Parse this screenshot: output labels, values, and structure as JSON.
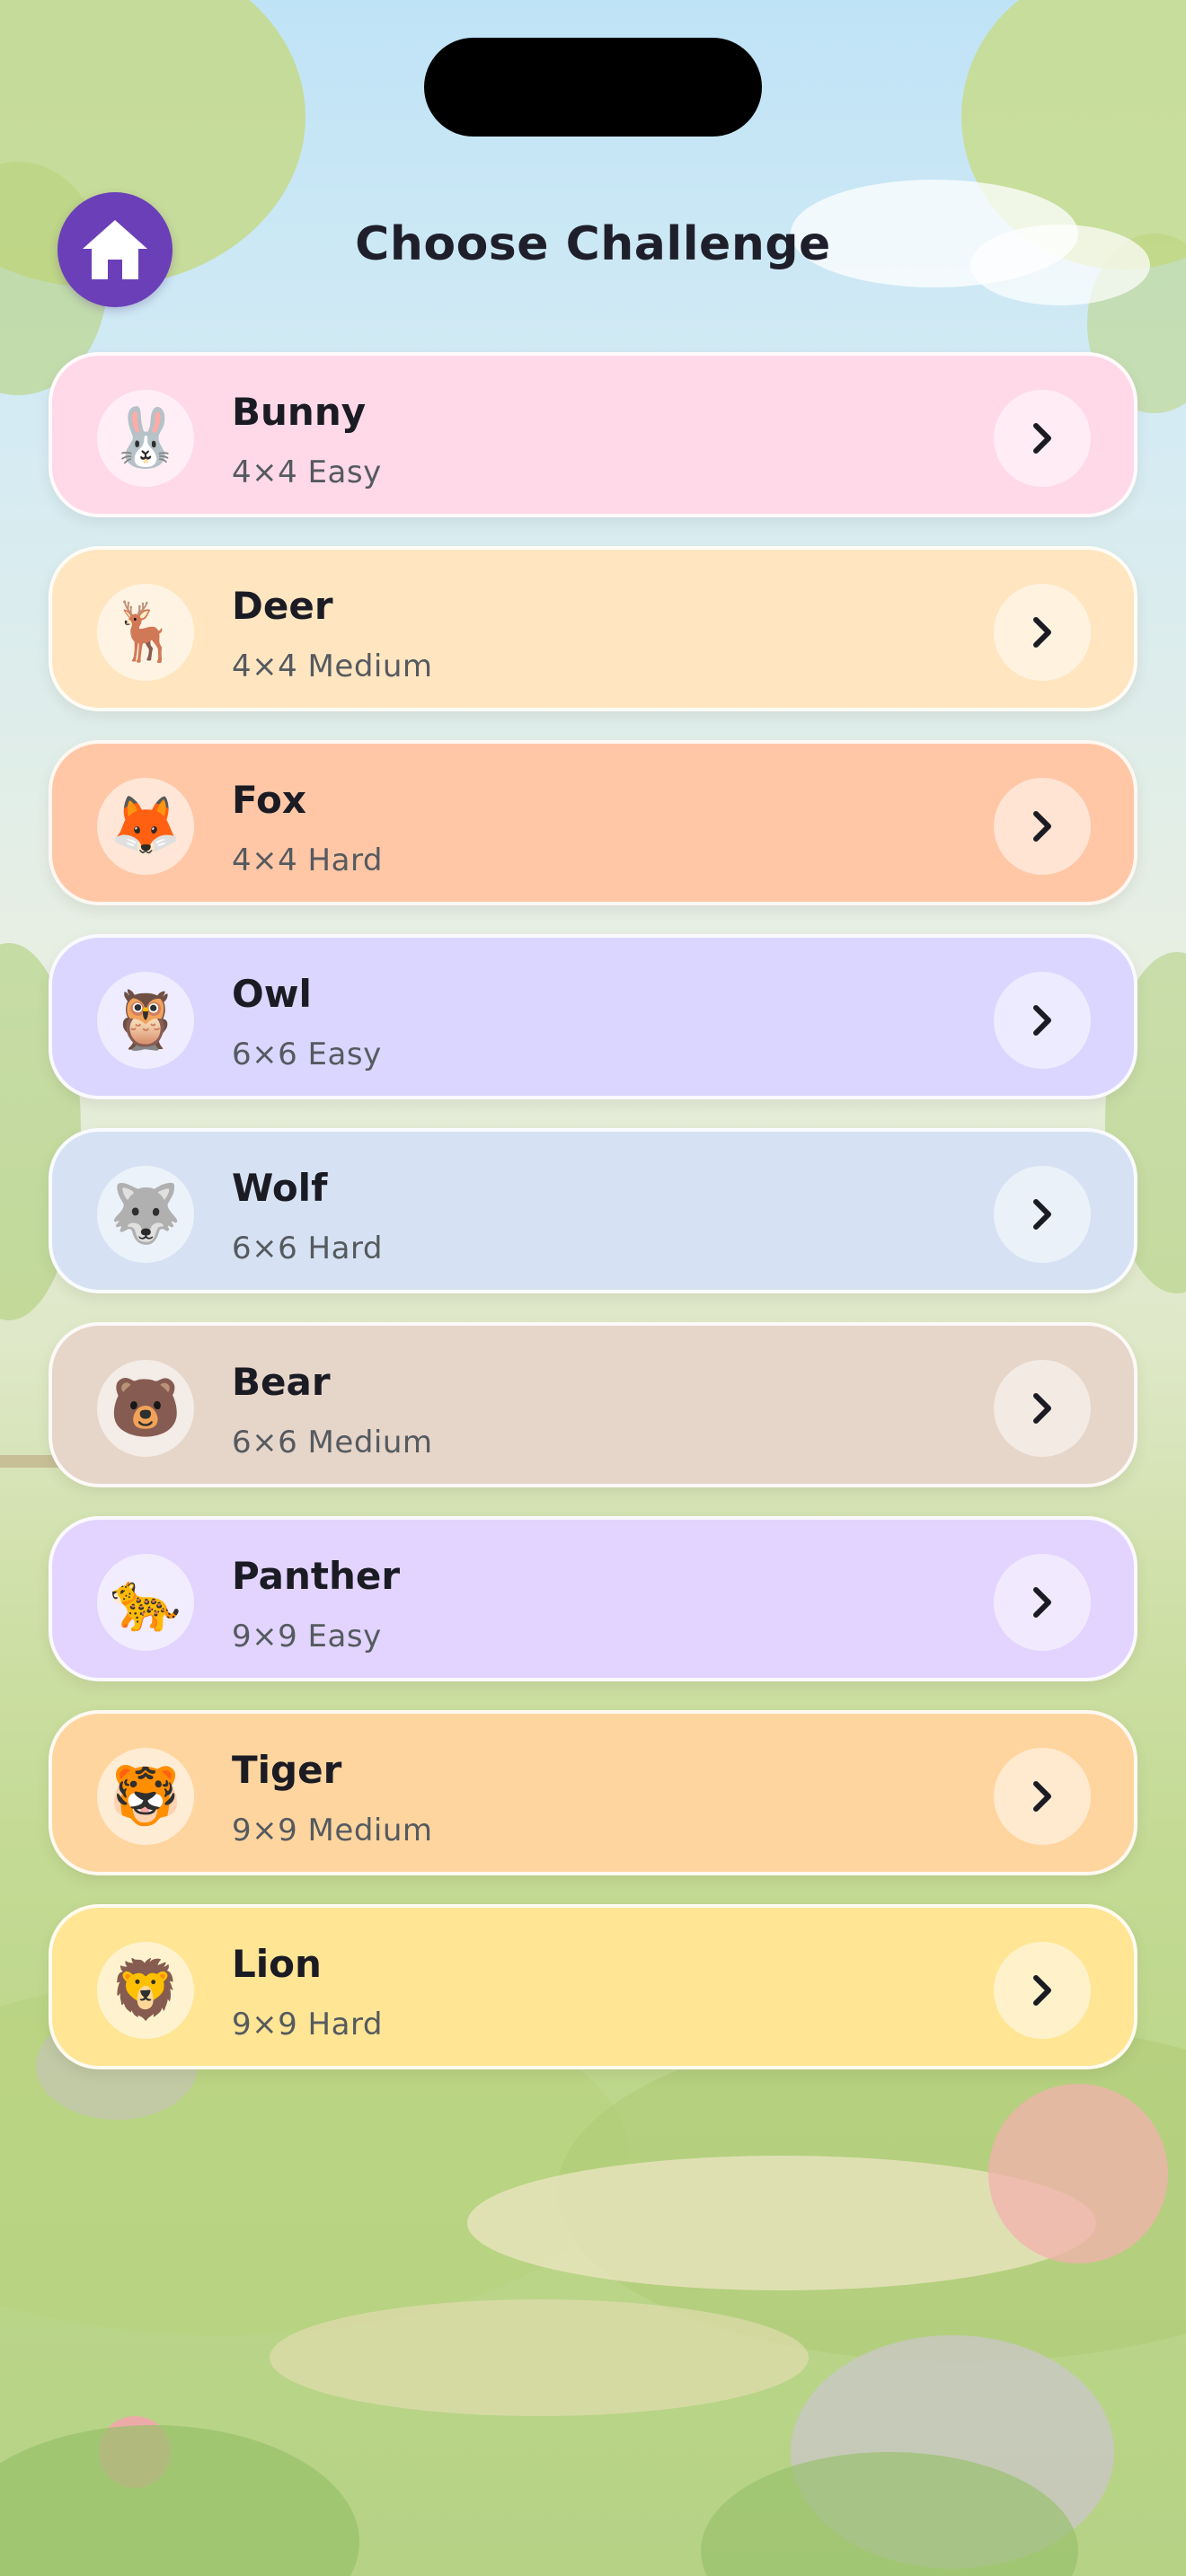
{
  "header": {
    "title": "Choose Challenge",
    "home_icon": "home-icon",
    "accent": "#6b3fb8"
  },
  "challenges": [
    {
      "name": "Bunny",
      "level": "4×4 Easy",
      "icon": "🐰",
      "color": "#ffd9e8"
    },
    {
      "name": "Deer",
      "level": "4×4 Medium",
      "icon": "🦌",
      "color": "#ffe6c1"
    },
    {
      "name": "Fox",
      "level": "4×4 Hard",
      "icon": "🦊",
      "color": "#ffc7a6"
    },
    {
      "name": "Owl",
      "level": "6×6 Easy",
      "icon": "🦉",
      "color": "#dbd6ff"
    },
    {
      "name": "Wolf",
      "level": "6×6 Hard",
      "icon": "🐺",
      "color": "#d6e2f3"
    },
    {
      "name": "Bear",
      "level": "6×6 Medium",
      "icon": "🐻",
      "color": "#e6d5c9"
    },
    {
      "name": "Panther",
      "level": "9×9 Easy",
      "icon": "🐆",
      "color": "#e2d4ff"
    },
    {
      "name": "Tiger",
      "level": "9×9 Medium",
      "icon": "🐯",
      "color": "#ffd59f"
    },
    {
      "name": "Lion",
      "level": "9×9 Hard",
      "icon": "🦁",
      "color": "#ffe594"
    }
  ],
  "go_icon": "chevron-right-icon"
}
